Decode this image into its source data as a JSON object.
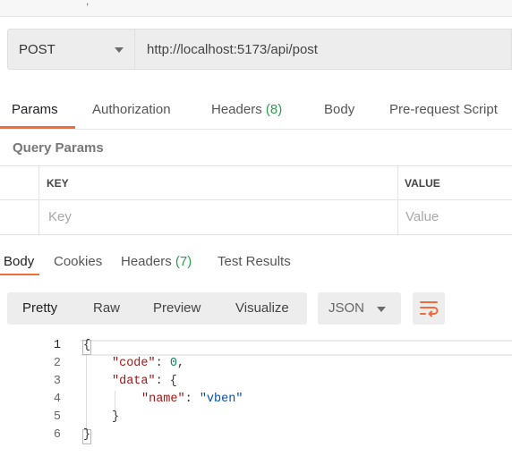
{
  "request": {
    "method": "POST",
    "url": "http://localhost:5173/api/post"
  },
  "request_tabs": [
    {
      "label": "Params"
    },
    {
      "label": "Authorization"
    },
    {
      "label": "Headers",
      "count": "(8)"
    },
    {
      "label": "Body"
    },
    {
      "label": "Pre-request Script"
    }
  ],
  "query_params": {
    "title": "Query Params",
    "columns": [
      "KEY",
      "VALUE"
    ],
    "placeholders": [
      "Key",
      "Value"
    ]
  },
  "response_tabs": [
    {
      "label": "Body"
    },
    {
      "label": "Cookies"
    },
    {
      "label": "Headers",
      "count": "(7)"
    },
    {
      "label": "Test Results"
    }
  ],
  "format_bar": {
    "buttons": [
      "Pretty",
      "Raw",
      "Preview",
      "Visualize"
    ],
    "selected_format": "JSON",
    "wrap_icon": "wrap-lines-icon"
  },
  "response_body": {
    "line_numbers": [
      "1",
      "2",
      "3",
      "4",
      "5",
      "6"
    ],
    "l1": "{",
    "l2_key": "\"code\"",
    "l2_colon": ": ",
    "l2_val": "0",
    "l2_comma": ",",
    "l3_key": "\"data\"",
    "l3_rest": ": {",
    "l4_key": "\"name\"",
    "l4_colon": ": ",
    "l4_val": "\"vben\"",
    "l5": "}",
    "l6": "}"
  },
  "colors": {
    "accent": "#f26b3a",
    "count_green": "#2e9b4f",
    "json_key": "#a31515",
    "json_string": "#0451a5",
    "json_number": "#098658"
  }
}
